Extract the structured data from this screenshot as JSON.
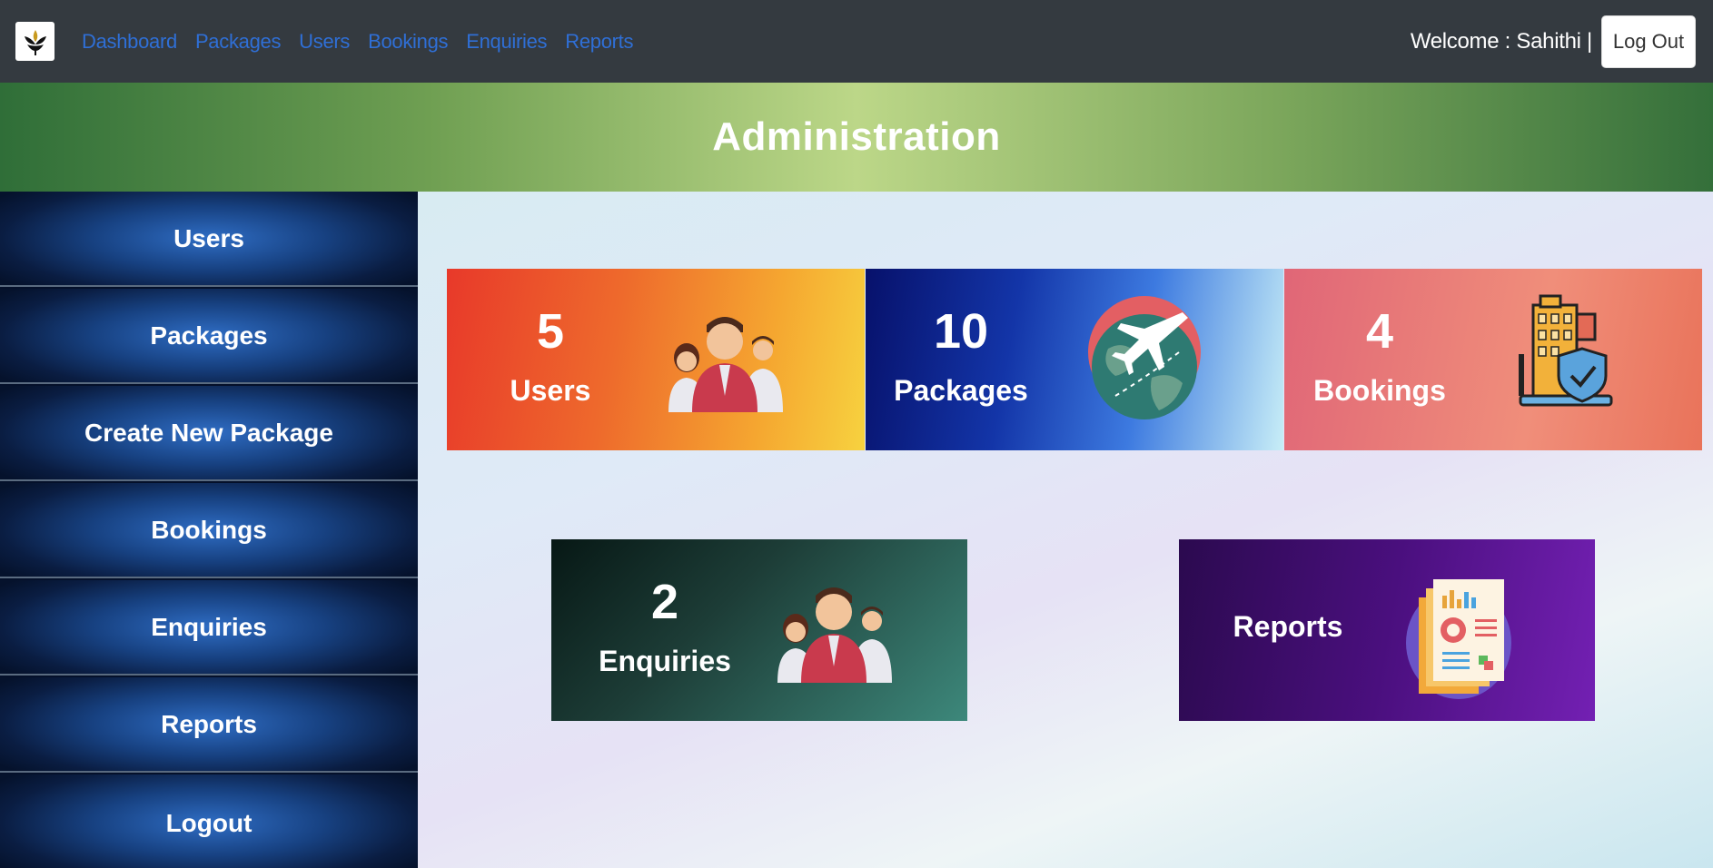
{
  "navbar": {
    "links": [
      "Dashboard",
      "Packages",
      "Users",
      "Bookings",
      "Enquiries",
      "Reports"
    ],
    "welcome": "Welcome : Sahithi |",
    "logout_label": "Log Out"
  },
  "banner": {
    "title": "Administration"
  },
  "sidebar": {
    "items": [
      {
        "label": "Users"
      },
      {
        "label": "Packages"
      },
      {
        "label": "Create New Package"
      },
      {
        "label": "Bookings"
      },
      {
        "label": "Enquiries"
      },
      {
        "label": "Reports"
      },
      {
        "label": "Logout"
      }
    ]
  },
  "cards": {
    "users": {
      "count": "5",
      "label": "Users",
      "icon": "people-icon"
    },
    "packages": {
      "count": "10",
      "label": "Packages",
      "icon": "globe-airplane-icon"
    },
    "bookings": {
      "count": "4",
      "label": "Bookings",
      "icon": "building-shield-icon"
    },
    "enquiries": {
      "count": "2",
      "label": "Enquiries",
      "icon": "people-icon"
    },
    "reports": {
      "label": "Reports",
      "icon": "report-document-icon"
    }
  },
  "colors": {
    "navbar": "#343a40",
    "nav_link": "#2f6fd6",
    "banner_center": "#bcd788",
    "sidebar": "#174181"
  }
}
